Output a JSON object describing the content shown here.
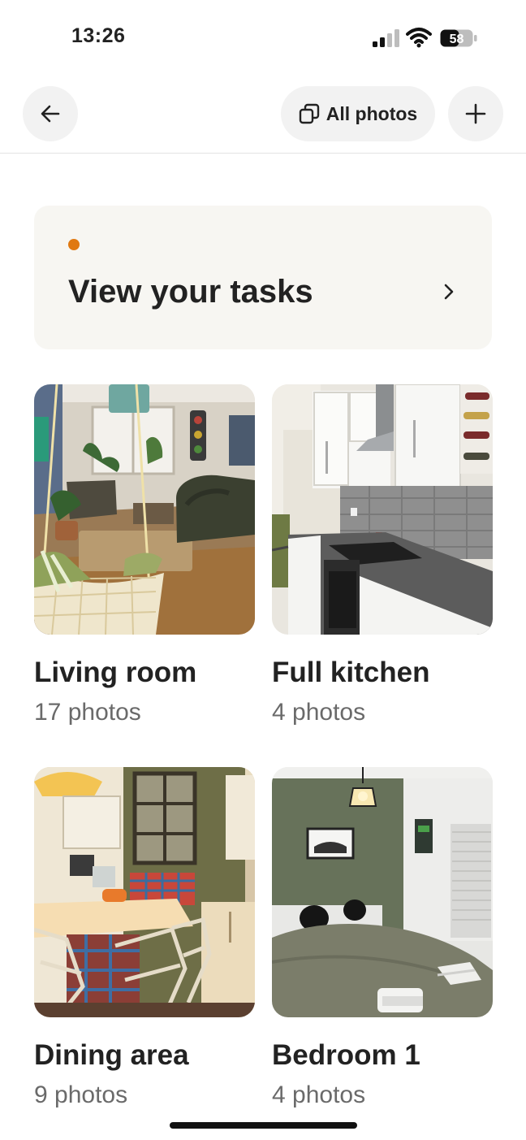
{
  "status": {
    "time": "13:26",
    "battery": "58"
  },
  "nav": {
    "back_icon": "arrow-left-icon",
    "all_photos_label": "All photos",
    "all_photos_icon": "photo-stack-icon",
    "add_icon": "plus-icon"
  },
  "tasks": {
    "title": "View your tasks",
    "dot_color": "#e07912"
  },
  "rooms": [
    {
      "name": "Living room",
      "count": "17 photos"
    },
    {
      "name": "Full kitchen",
      "count": "4 photos"
    },
    {
      "name": "Dining area",
      "count": "9 photos"
    },
    {
      "name": "Bedroom 1",
      "count": "4 photos"
    }
  ]
}
